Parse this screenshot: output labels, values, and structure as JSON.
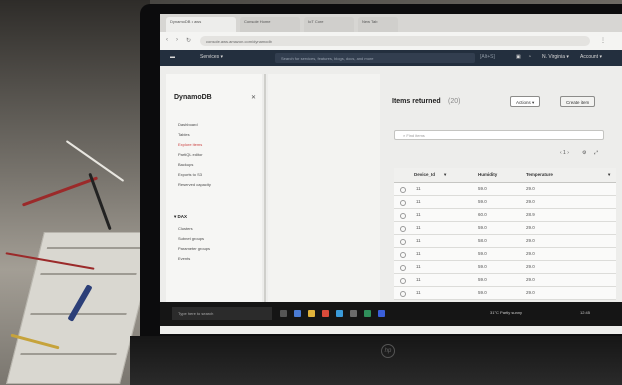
{
  "browser": {
    "tabs": [
      "DynamoDB • aws",
      "Console Home",
      "IoT Core",
      "New Tab"
    ],
    "address": "console.aws.amazon.com/dynamodb"
  },
  "aws_header": {
    "services_label": "Services ▾",
    "search_placeholder": "Search for services, features, blogs, docs, and more",
    "search_shortcut": "[Alt+S]",
    "region_label": "N. Virginia ▾",
    "account_label": "Account ▾"
  },
  "sidebar": {
    "title": "DynamoDB",
    "close_label": "✕",
    "items": [
      {
        "label": "Dashboard",
        "active": false
      },
      {
        "label": "Tables",
        "active": false
      },
      {
        "label": "Explore items",
        "active": true
      },
      {
        "label": "PartiQL editor",
        "active": false
      },
      {
        "label": "Backups",
        "active": false
      },
      {
        "label": "Exports to S3",
        "active": false
      },
      {
        "label": "Reserved capacity",
        "active": false
      }
    ],
    "section": "▾ DAX",
    "dax_items": [
      "Clusters",
      "Subnet groups",
      "Parameter groups",
      "Events"
    ]
  },
  "main": {
    "title": "Items returned",
    "count": "(20)",
    "actions_label": "Actions ▾",
    "create_label": "Create item",
    "filter_placeholder": "Find items",
    "pager": "‹ 1 ›",
    "columns": [
      "Device_Id",
      "Humidity",
      "Temperature"
    ],
    "rows": [
      {
        "id": "11",
        "humidity": "59.0",
        "temperature": "29.0"
      },
      {
        "id": "11",
        "humidity": "59.0",
        "temperature": "29.0"
      },
      {
        "id": "11",
        "humidity": "60.0",
        "temperature": "28.9"
      },
      {
        "id": "11",
        "humidity": "59.0",
        "temperature": "29.0"
      },
      {
        "id": "11",
        "humidity": "58.0",
        "temperature": "29.0"
      },
      {
        "id": "11",
        "humidity": "59.0",
        "temperature": "29.0"
      },
      {
        "id": "11",
        "humidity": "59.0",
        "temperature": "29.0"
      },
      {
        "id": "11",
        "humidity": "59.0",
        "temperature": "29.0"
      },
      {
        "id": "11",
        "humidity": "59.0",
        "temperature": "29.0"
      }
    ]
  },
  "taskbar": {
    "search_placeholder": "Type here to search",
    "weather": "31°C  Partly sunny",
    "clock": "12:45"
  },
  "colors": {
    "aws_header": "#232f3e",
    "active_nav": "#c44444"
  }
}
